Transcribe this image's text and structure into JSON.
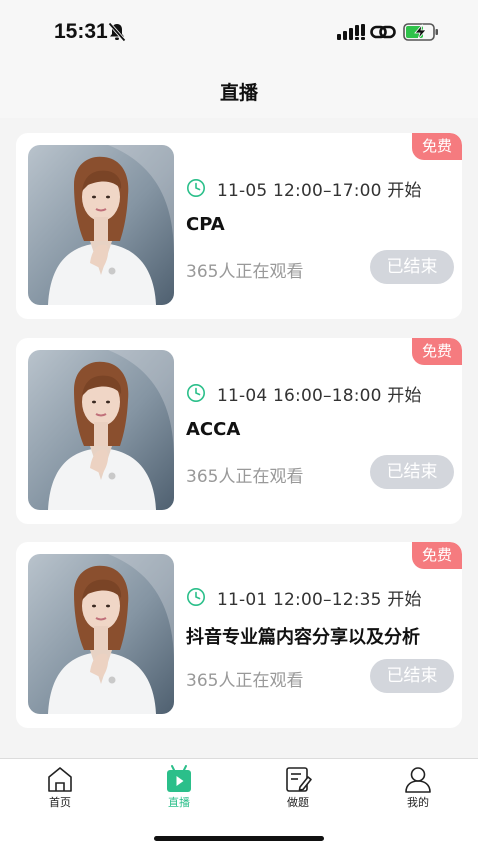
{
  "status_bar": {
    "time": "15:31"
  },
  "page": {
    "title": "直播"
  },
  "colors": {
    "accent": "#2bbf8a",
    "badge": "#f57b7f",
    "ended_button": "#d3d6dc",
    "muted_text": "#999999"
  },
  "cards": [
    {
      "badge": "免费",
      "time": "11-05 12:00–17:00 开始",
      "title": "CPA",
      "viewers": "365人正在观看",
      "status": "已结束"
    },
    {
      "badge": "免费",
      "time": "11-04 16:00–18:00 开始",
      "title": "ACCA",
      "viewers": "365人正在观看",
      "status": "已结束"
    },
    {
      "badge": "免费",
      "time": "11-01 12:00–12:35 开始",
      "title": "抖音专业篇内容分享以及分析",
      "viewers": "365人正在观看",
      "status": "已结束"
    }
  ],
  "tab_bar": {
    "items": [
      {
        "label": "首页",
        "icon": "home-icon",
        "active": false
      },
      {
        "label": "直播",
        "icon": "live-tv-icon",
        "active": true
      },
      {
        "label": "做题",
        "icon": "exercise-edit-icon",
        "active": false
      },
      {
        "label": "我的",
        "icon": "user-icon",
        "active": false
      }
    ]
  }
}
